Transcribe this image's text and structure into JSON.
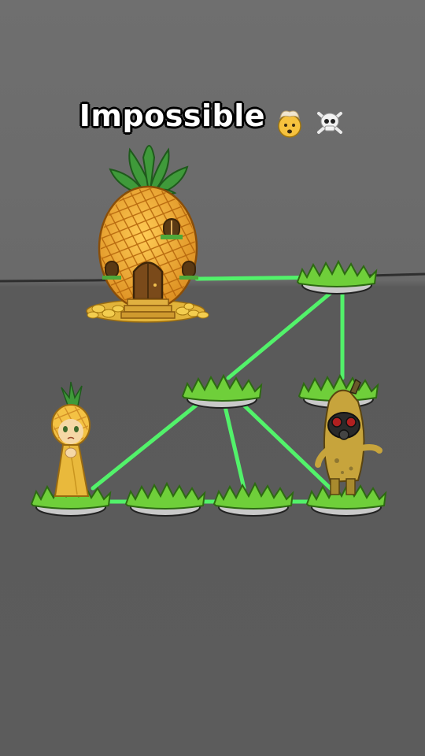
{
  "title": "Impossible",
  "title_emojis": [
    "exploding-head-icon",
    "skull-crossbones-icon"
  ],
  "colors": {
    "background": "#5f5f5f",
    "path_line": "#52f26a",
    "grass": "#6fcf3a",
    "platform": "#c9c9c9"
  },
  "scene": {
    "house": "pineapple-house",
    "player": "pineapple-princess",
    "enemy": "banana-gasmask-monster"
  }
}
